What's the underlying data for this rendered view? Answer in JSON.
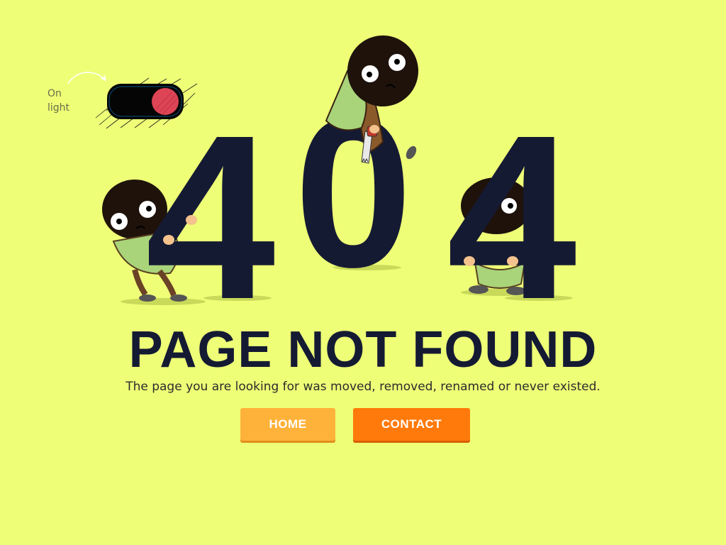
{
  "switch": {
    "label_line1": "On",
    "label_line2": "light",
    "state": "on",
    "knob_color": "#dd4455"
  },
  "hero": {
    "code_digit_1": "4",
    "code_digit_2": "0",
    "code_digit_3": "4"
  },
  "title": "PAGE NOT FOUND",
  "subtitle": "The page you are looking for was moved, removed, renamed or never existed.",
  "buttons": {
    "home_label": "HOME",
    "contact_label": "CONTACT"
  },
  "colors": {
    "background": "#eeff77",
    "text_dark": "#151a33",
    "home_button": "#ffb23a",
    "contact_button": "#ff7a0a"
  }
}
